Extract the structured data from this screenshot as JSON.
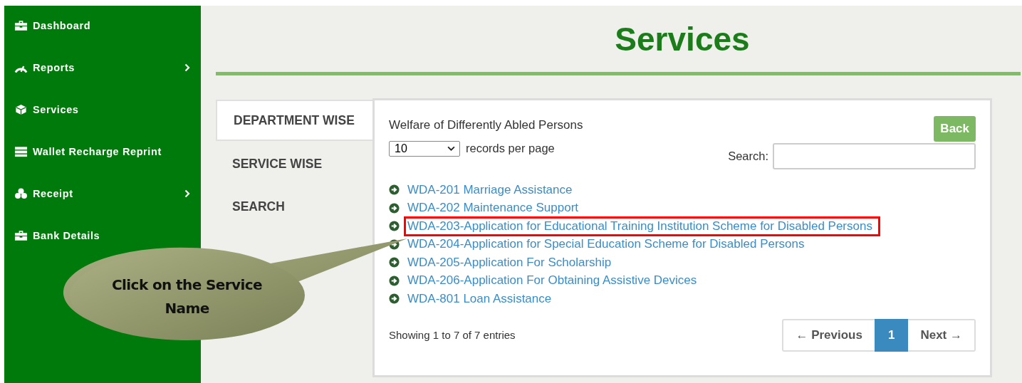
{
  "sidebar": {
    "items": [
      {
        "label": "Dashboard",
        "submenu": false
      },
      {
        "label": "Reports",
        "submenu": true
      },
      {
        "label": "Services",
        "submenu": false
      },
      {
        "label": "Wallet Recharge Reprint",
        "submenu": false
      },
      {
        "label": "Receipt",
        "submenu": true
      },
      {
        "label": "Bank Details",
        "submenu": false
      }
    ]
  },
  "page_title": "Services",
  "tabs": [
    {
      "label": "DEPARTMENT WISE",
      "selected": true
    },
    {
      "label": "SERVICE WISE",
      "selected": false
    },
    {
      "label": "SEARCH",
      "selected": false
    }
  ],
  "panel": {
    "heading": "Welfare of Differently Abled Persons",
    "back_button": "Back",
    "page_size": "10",
    "page_size_label": "records per page",
    "search_label": "Search:",
    "services": [
      {
        "label": "WDA-201 Marriage Assistance",
        "highlighted": false
      },
      {
        "label": "WDA-202 Maintenance Support",
        "highlighted": false
      },
      {
        "label": "WDA-203-Application for Educational Training Institution Scheme for Disabled Persons",
        "highlighted": true
      },
      {
        "label": "WDA-204-Application for Special Education Scheme for Disabled Persons",
        "highlighted": false
      },
      {
        "label": "WDA-205-Application For Scholarship",
        "highlighted": false
      },
      {
        "label": "WDA-206-Application For Obtaining Assistive Devices",
        "highlighted": false
      },
      {
        "label": "WDA-801 Loan Assistance",
        "highlighted": false
      }
    ],
    "info": "Showing 1 to 7 of 7 entries",
    "pagination": [
      {
        "label": "← Previous",
        "kind": "nav",
        "selected": false
      },
      {
        "label": "1",
        "kind": "page",
        "selected": true
      },
      {
        "label": "Next →",
        "kind": "nav",
        "selected": false
      }
    ]
  },
  "callout": {
    "text": "Click on the Service Name"
  }
}
